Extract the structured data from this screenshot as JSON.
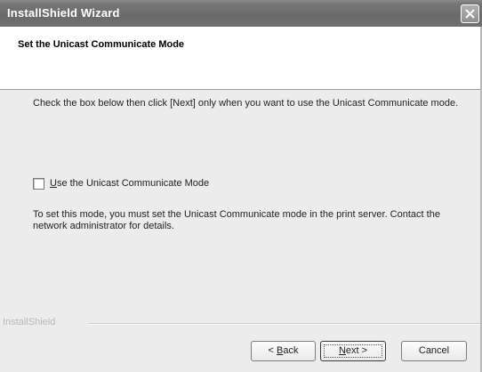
{
  "window": {
    "title": "InstallShield Wizard"
  },
  "header": {
    "title": "Set the Unicast Communicate Mode"
  },
  "body": {
    "intro": "Check the box below then click [Next] only when you want to use the Unicast Communicate mode.",
    "checkbox": {
      "label_mnemonic": "U",
      "label_rest": "se the Unicast Communicate Mode",
      "checked": false
    },
    "note": "To set this mode, you must set the Unicast Communicate mode in the print server. Contact the network administrator for details."
  },
  "footer": {
    "brand": "InstallShield",
    "back": {
      "arrow": "< ",
      "mnemonic": "B",
      "rest": "ack"
    },
    "next": {
      "mnemonic": "N",
      "rest": "ext >"
    },
    "cancel": "Cancel"
  },
  "icons": {
    "close": "close-icon"
  }
}
